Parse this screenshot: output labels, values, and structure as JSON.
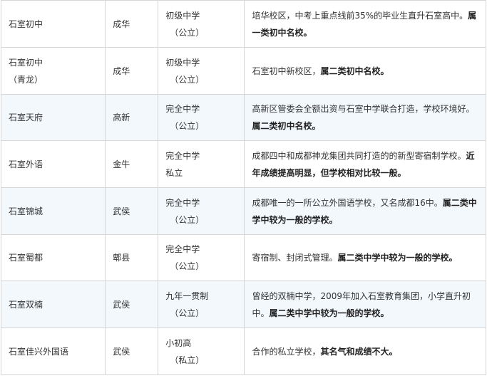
{
  "rows": [
    {
      "name": [
        "石室初中"
      ],
      "district": "成华",
      "type": [
        "初级中学",
        "（公立）"
      ],
      "desc_plain": "培华校区，中考上重点线前35%的毕业生直升石室高中。",
      "desc_bold": "属一类初中名校。"
    },
    {
      "name": [
        "石室初中",
        "（青龙）"
      ],
      "district": "成华",
      "type": [
        "初级中学",
        "（公立）"
      ],
      "desc_plain": "石室初中新校区，",
      "desc_bold": "属二类初中名校。"
    },
    {
      "name": [
        "石室天府"
      ],
      "district": "高新",
      "type": [
        "完全中学",
        "（公立）"
      ],
      "desc_plain": "高新区管委会全额出资与石室中学联合打造，学校环境好。",
      "desc_bold": "属二类初中名校。"
    },
    {
      "name": [
        "石室外语"
      ],
      "district": "金牛",
      "type": [
        "完全中学",
        "私立"
      ],
      "desc_plain": "成都四中和成都神龙集团共同打造的的新型寄宿制学校。",
      "desc_bold": "近年成绩提高明显，但学校相对比较一般。"
    },
    {
      "name": [
        "石室锦城"
      ],
      "district": "武侯",
      "type": [
        "完全中学",
        "（公立）"
      ],
      "desc_plain": "成都唯一的一所公立外国语学校，又名成都16中。",
      "desc_bold": "属二类中学中较为一般的学校。"
    },
    {
      "name": [
        "石室蜀都"
      ],
      "district": "郫县",
      "type": [
        "完全中学",
        "（公立）"
      ],
      "desc_plain": "寄宿制、封闭式管理。",
      "desc_bold": "属二类中学中较为一般的学校。"
    },
    {
      "name": [
        "石室双楠"
      ],
      "district": "武侯",
      "type": [
        "九年一贯制",
        "（公立）"
      ],
      "desc_plain": "曾经的双楠中学，2009年加入石室教育集团，小学直升初中。",
      "desc_bold": "属二类中学中较为一般的学校。"
    },
    {
      "name": [
        "石室佳兴外国语"
      ],
      "district": "武侯",
      "type": [
        "小初高",
        "（私立）"
      ],
      "desc_plain": "合作的私立学校，",
      "desc_bold": "其名气和成绩不大。"
    }
  ]
}
